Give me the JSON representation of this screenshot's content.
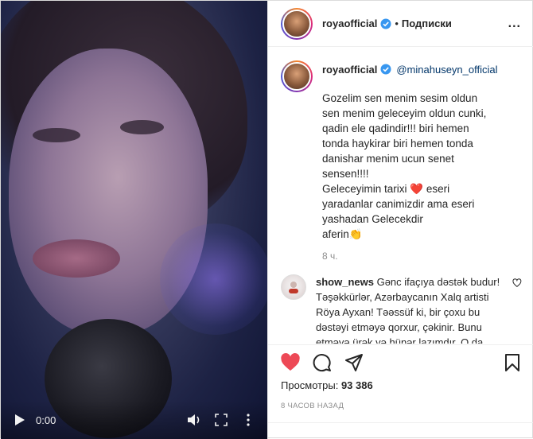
{
  "video": {
    "current_time": "0:00",
    "play_icon": "play-icon",
    "mute_icon": "volume-icon",
    "fullscreen_icon": "fullscreen-icon"
  },
  "header": {
    "username": "royaofficial",
    "verified_icon": "verified-badge-icon",
    "separator": "•",
    "follow_label": "Подписки",
    "more_label": "..."
  },
  "caption": {
    "username": "royaofficial",
    "mention": "@minahuseyn_official",
    "text_part1": "Gozelim sen menim sesim oldun sen menim geleceyim oldun cunki, qadin ele qadindir!!! biri hemen tonda haykirar biri hemen tonda danishar menim ucun senet sensen!!!!\nGeleceyimin tarixi ",
    "heart_emoji": "❤️",
    "text_part2": " eseri yaradanlar canimizdir ama eseri yashadan Gelecekdir\naferin",
    "clap_emoji": "👏",
    "time_ago": "8 ч."
  },
  "comments": [
    {
      "username": "show_news",
      "text": "Gənc ifaçıya dəstək budur! Təşəkkürlər, Azərbaycanın Xalq artisti Röya Ayxan! Təəssüf ki, bir çoxu bu dəstəyi etməyə qorxur, çəkinir. Bunu etməyə ürək və hünər lazımdır. O da bizim əsas"
    }
  ],
  "actions": {
    "like_icon": "heart-filled-icon",
    "comment_icon": "comment-icon",
    "share_icon": "share-icon",
    "save_icon": "bookmark-icon",
    "liked": true,
    "like_color": "#ed4956"
  },
  "views": {
    "label": "Просмотры:",
    "count": "93 386"
  },
  "timestamp": "8 ЧАСОВ НАЗАД"
}
